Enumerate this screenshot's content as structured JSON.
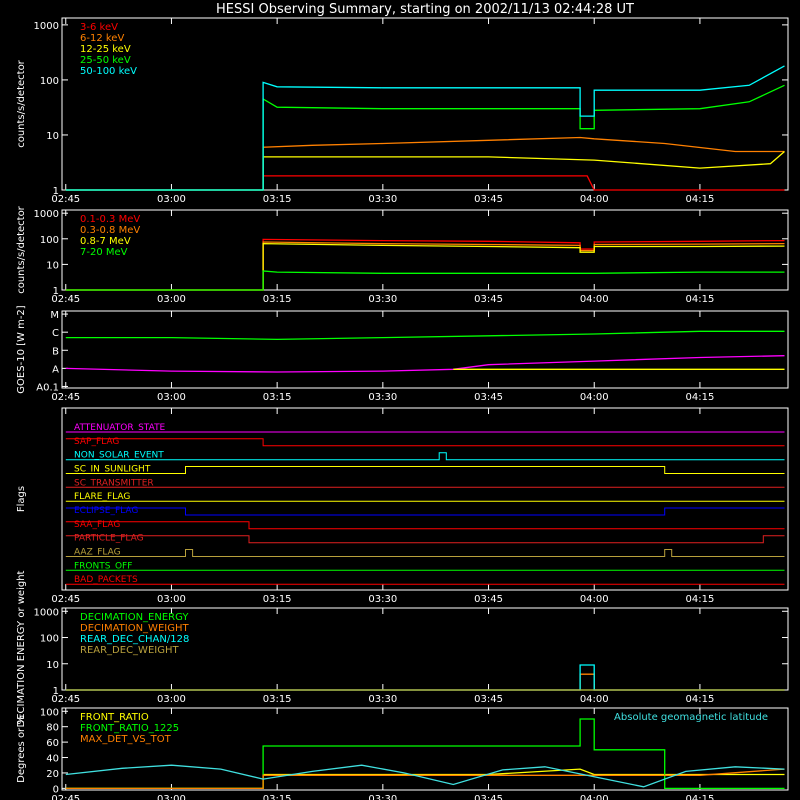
{
  "title": "HESSI Observing Summary, starting on 2002/11/13 02:44:28 UT",
  "colors": {
    "background": "#000000",
    "axis": "#ffffff",
    "red": "#ff0000",
    "orange": "#ff8000",
    "yellow": "#ffff00",
    "green": "#00ff00",
    "cyan": "#00ffff",
    "magenta": "#ff00ff",
    "blue": "#0000ff",
    "olive": "#b8a03c",
    "crimson": "#e02020",
    "lightcyan": "#40e0e0"
  },
  "time_ticks": [
    "02:45",
    "03:00",
    "03:15",
    "03:30",
    "03:45",
    "04:00",
    "04:15"
  ],
  "chart_data": [
    {
      "id": "rates_low",
      "type": "line",
      "ylabel": "counts/s/detector",
      "yscale": "log",
      "ylim": [
        1,
        1000
      ],
      "yticks": [
        "1",
        "10",
        "100",
        "1000"
      ],
      "legend_placement": "top-left",
      "series": [
        {
          "name": "3-6 keV",
          "color": "red",
          "x": [
            "03:13",
            "03:20",
            "03:30",
            "03:45",
            "03:59",
            "04:00",
            "04:15",
            "04:20",
            "04:25",
            "04:27"
          ],
          "y": [
            1.8,
            1.8,
            1.8,
            1.8,
            1.8,
            1,
            1,
            1,
            1,
            1
          ]
        },
        {
          "name": "6-12 keV",
          "color": "orange",
          "x": [
            "02:45",
            "03:13",
            "03:13",
            "03:20",
            "03:30",
            "03:45",
            "03:58",
            "04:00",
            "04:10",
            "04:20",
            "04:27"
          ],
          "y": [
            1,
            1,
            6,
            6.5,
            7,
            8,
            9,
            8.5,
            7,
            5,
            5
          ]
        },
        {
          "name": "12-25 keV",
          "color": "yellow",
          "x": [
            "02:45",
            "03:13",
            "03:13",
            "03:30",
            "03:45",
            "04:00",
            "04:15",
            "04:25",
            "04:27"
          ],
          "y": [
            1,
            1,
            4,
            4,
            4,
            3.5,
            2.5,
            3,
            5
          ]
        },
        {
          "name": "25-50 keV",
          "color": "green",
          "x": [
            "02:45",
            "03:13",
            "03:13",
            "03:15",
            "03:30",
            "03:45",
            "03:58",
            "03:58",
            "04:00",
            "04:00",
            "04:15",
            "04:22",
            "04:27"
          ],
          "y": [
            1,
            1,
            45,
            32,
            30,
            30,
            30,
            13,
            13,
            28,
            30,
            40,
            80
          ]
        },
        {
          "name": "50-100 keV",
          "color": "cyan",
          "x": [
            "02:45",
            "03:13",
            "03:13",
            "03:15",
            "03:30",
            "03:45",
            "03:58",
            "03:58",
            "04:00",
            "04:00",
            "04:15",
            "04:22",
            "04:27"
          ],
          "y": [
            1,
            1,
            90,
            75,
            72,
            72,
            72,
            22,
            22,
            65,
            65,
            80,
            180
          ]
        }
      ]
    },
    {
      "id": "rates_high",
      "type": "line",
      "ylabel": "counts/s/detector",
      "yscale": "log",
      "ylim": [
        1,
        1000
      ],
      "yticks": [
        "1",
        "10",
        "100",
        "1000"
      ],
      "legend_placement": "top-left",
      "series": [
        {
          "name": "0.1-0.3 MeV",
          "color": "red",
          "x": [
            "02:45",
            "03:13",
            "03:13",
            "03:30",
            "03:45",
            "03:58",
            "03:58",
            "04:00",
            "04:00",
            "04:15",
            "04:27"
          ],
          "y": [
            1,
            1,
            95,
            85,
            80,
            70,
            40,
            40,
            75,
            80,
            85
          ]
        },
        {
          "name": "0.3-0.8 MeV",
          "color": "orange",
          "x": [
            "02:45",
            "03:13",
            "03:13",
            "03:30",
            "03:45",
            "03:58",
            "03:58",
            "04:00",
            "04:00",
            "04:15",
            "04:27"
          ],
          "y": [
            1,
            1,
            75,
            65,
            60,
            55,
            35,
            35,
            60,
            62,
            65
          ]
        },
        {
          "name": "0.8-7 MeV",
          "color": "yellow",
          "x": [
            "02:45",
            "03:13",
            "03:13",
            "03:30",
            "03:45",
            "03:58",
            "03:58",
            "04:00",
            "04:00",
            "04:15",
            "04:27"
          ],
          "y": [
            1,
            1,
            65,
            55,
            50,
            45,
            30,
            30,
            50,
            50,
            52
          ]
        },
        {
          "name": "7-20 MeV",
          "color": "green",
          "x": [
            "02:45",
            "03:13",
            "03:13",
            "03:15",
            "03:30",
            "03:45",
            "04:00",
            "04:15",
            "04:27"
          ],
          "y": [
            1,
            1,
            5.5,
            5,
            4.5,
            4.5,
            4.5,
            5,
            5
          ]
        }
      ]
    },
    {
      "id": "goes",
      "type": "line",
      "ylabel": "GOES-10 [W m-2]",
      "yticks": [
        "A0.1",
        "A",
        "B",
        "C",
        "M"
      ],
      "ylim": [
        0,
        4
      ],
      "series": [
        {
          "color": "green",
          "x": [
            "02:45",
            "03:00",
            "03:15",
            "03:30",
            "03:45",
            "04:00",
            "04:15",
            "04:27"
          ],
          "y": [
            2.7,
            2.7,
            2.6,
            2.7,
            2.8,
            2.9,
            3.05,
            3.05
          ]
        },
        {
          "color": "magenta",
          "x": [
            "02:45",
            "03:00",
            "03:15",
            "03:30",
            "03:40",
            "03:45",
            "04:00",
            "04:15",
            "04:27"
          ],
          "y": [
            1.0,
            0.85,
            0.8,
            0.85,
            0.95,
            1.2,
            1.4,
            1.6,
            1.7
          ]
        },
        {
          "color": "yellow",
          "x": [
            "03:40",
            "04:27"
          ],
          "y": [
            0.95,
            0.95
          ]
        }
      ]
    },
    {
      "id": "flags",
      "type": "line",
      "ylabel": "Flags",
      "flags": [
        {
          "name": "ATTENUATOR_STATE",
          "color": "magenta",
          "x": [
            "02:45",
            "04:27"
          ],
          "y": [
            0,
            0
          ]
        },
        {
          "name": "SAP_FLAG",
          "color": "red",
          "x": [
            "02:45",
            "03:13",
            "03:13",
            "04:27"
          ],
          "y": [
            1,
            1,
            0,
            0
          ]
        },
        {
          "name": "NON_SOLAR_EVENT",
          "color": "cyan",
          "x": [
            "02:45",
            "03:38",
            "03:38",
            "03:39",
            "03:39",
            "04:27"
          ],
          "y": [
            0,
            0,
            1,
            1,
            0,
            0
          ]
        },
        {
          "name": "SC_IN_SUNLIGHT",
          "color": "yellow",
          "x": [
            "02:45",
            "03:02",
            "03:02",
            "04:10",
            "04:10",
            "04:27"
          ],
          "y": [
            0,
            0,
            1,
            1,
            0,
            0
          ]
        },
        {
          "name": "SC_TRANSMITTER",
          "color": "crimson",
          "x": [
            "02:45",
            "04:27"
          ],
          "y": [
            0,
            0
          ]
        },
        {
          "name": "FLARE_FLAG",
          "color": "yellow",
          "x": [
            "02:45",
            "04:27"
          ],
          "y": [
            0,
            0
          ]
        },
        {
          "name": "ECLIPSE_FLAG",
          "color": "blue",
          "x": [
            "02:45",
            "03:02",
            "03:02",
            "04:10",
            "04:10",
            "04:27"
          ],
          "y": [
            1,
            1,
            0,
            0,
            1,
            1
          ]
        },
        {
          "name": "SAA_FLAG",
          "color": "red",
          "x": [
            "02:45",
            "03:11",
            "03:11",
            "04:27"
          ],
          "y": [
            1,
            1,
            0,
            0
          ]
        },
        {
          "name": "PARTICLE_FLAG",
          "color": "crimson",
          "x": [
            "02:45",
            "03:11",
            "03:11",
            "04:24",
            "04:24",
            "04:27"
          ],
          "y": [
            1,
            1,
            0,
            0,
            1,
            1
          ]
        },
        {
          "name": "AAZ_FLAG",
          "color": "olive",
          "x": [
            "02:45",
            "03:02",
            "03:02",
            "03:03",
            "03:03",
            "04:10",
            "04:10",
            "04:11",
            "04:11",
            "04:27"
          ],
          "y": [
            0,
            0,
            1,
            1,
            0,
            0,
            1,
            1,
            0,
            0
          ]
        },
        {
          "name": "FRONTS_OFF",
          "color": "green",
          "x": [
            "02:45",
            "04:27"
          ],
          "y": [
            0,
            0
          ]
        },
        {
          "name": "BAD_PACKETS",
          "color": "red",
          "x": [
            "02:45",
            "04:27"
          ],
          "y": [
            0,
            0
          ]
        }
      ]
    },
    {
      "id": "decimation",
      "type": "line",
      "ylabel": "DECIMATION ENERGY or weight",
      "yscale": "log",
      "ylim": [
        1,
        1000
      ],
      "yticks": [
        "1",
        "10",
        "100",
        "1000"
      ],
      "legend_placement": "top-left",
      "series": [
        {
          "name": "DECIMATION_ENERGY",
          "color": "green",
          "x": [
            "02:45",
            "04:27"
          ],
          "y": [
            1,
            1
          ]
        },
        {
          "name": "DECIMATION_WEIGHT",
          "color": "orange",
          "x": [
            "02:45",
            "03:58",
            "03:58",
            "04:00",
            "04:00",
            "04:27"
          ],
          "y": [
            1,
            1,
            4,
            4,
            1,
            1
          ]
        },
        {
          "name": "REAR_DEC_CHAN/128",
          "color": "cyan",
          "x": [
            "02:45",
            "03:58",
            "03:58",
            "04:00",
            "04:00",
            "04:27"
          ],
          "y": [
            1,
            1,
            9,
            9,
            1,
            1
          ]
        },
        {
          "name": "REAR_DEC_WEIGHT",
          "color": "olive",
          "x": [
            "02:45",
            "04:27"
          ],
          "y": [
            1,
            1
          ]
        }
      ]
    },
    {
      "id": "ratios",
      "type": "line",
      "ylabel": "Degrees or %",
      "ylim": [
        0,
        100
      ],
      "yticks": [
        "0",
        "20",
        "40",
        "60",
        "80",
        "100"
      ],
      "legend_placement": "top-left",
      "annotation": "Absolute geomagnetic latitude",
      "series": [
        {
          "name": "FRONT_RATIO",
          "color": "yellow",
          "x": [
            "02:45",
            "03:13",
            "03:13",
            "03:30",
            "03:45",
            "03:58",
            "04:00",
            "04:15",
            "04:27"
          ],
          "y": [
            0,
            0,
            18,
            18,
            18,
            25,
            18,
            18,
            18
          ]
        },
        {
          "name": "FRONT_RATIO_1225",
          "color": "green",
          "x": [
            "02:45",
            "03:13",
            "03:13",
            "03:30",
            "03:45",
            "03:58",
            "03:58",
            "04:00",
            "04:00",
            "04:10",
            "04:10",
            "04:27"
          ],
          "y": [
            0,
            0,
            55,
            55,
            55,
            55,
            90,
            90,
            50,
            50,
            0,
            0
          ]
        },
        {
          "name": "MAX_DET_VS_TOT",
          "color": "orange",
          "x": [
            "02:45",
            "03:13",
            "03:13",
            "03:30",
            "03:45",
            "04:00",
            "04:15",
            "04:27"
          ],
          "y": [
            0,
            0,
            17,
            17,
            17,
            17,
            17,
            25
          ]
        },
        {
          "name": "Absolute geomagnetic latitude",
          "color": "lightcyan",
          "x": [
            "02:45",
            "02:53",
            "03:00",
            "03:07",
            "03:13",
            "03:20",
            "03:27",
            "03:33",
            "03:40",
            "03:47",
            "03:53",
            "04:00",
            "04:07",
            "04:13",
            "04:20",
            "04:27"
          ],
          "y": [
            18,
            26,
            30,
            25,
            12,
            22,
            30,
            20,
            5,
            24,
            28,
            15,
            2,
            22,
            28,
            25
          ]
        }
      ]
    }
  ]
}
